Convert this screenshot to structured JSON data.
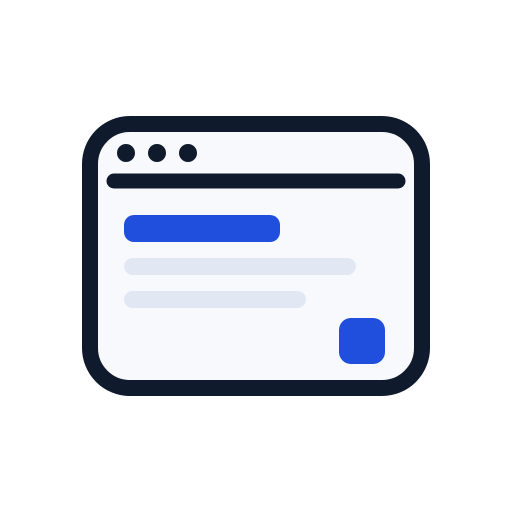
{
  "illustration": {
    "name": "browser-window-icon",
    "colors": {
      "outline": "#0f1b2d",
      "window_fill": "#f7f9fc",
      "accent": "#1f4fdc",
      "placeholder_line": "#e1e8f3"
    },
    "window_controls": [
      "dot",
      "dot",
      "dot"
    ],
    "content": {
      "heading_bar": "accent",
      "text_lines": 2,
      "action_button": "accent"
    }
  }
}
